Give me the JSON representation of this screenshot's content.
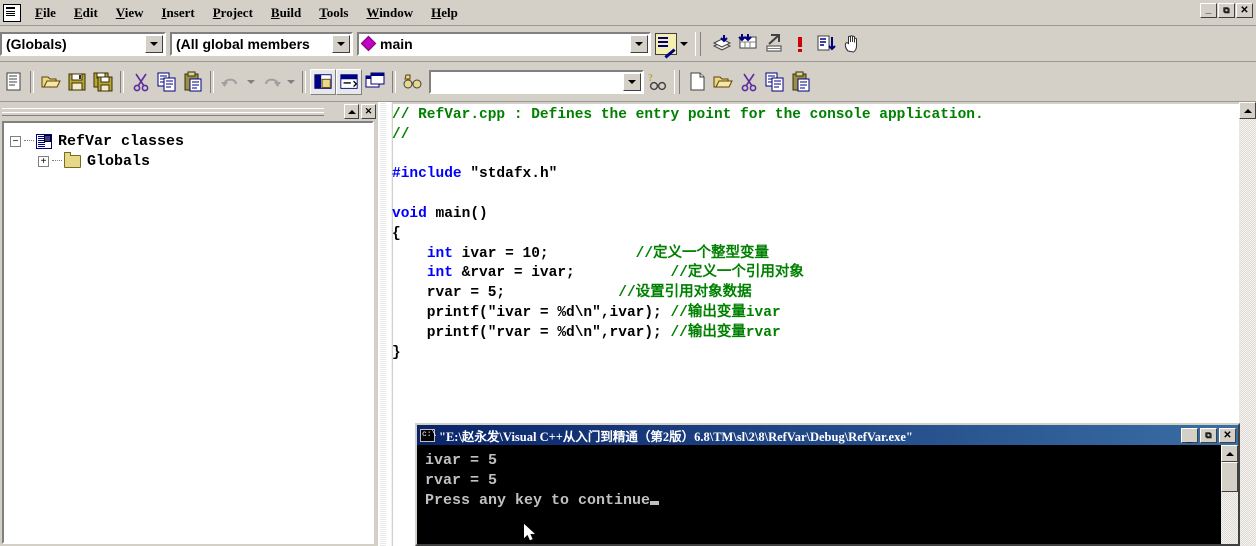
{
  "window": {
    "sys_icon": "app-icon",
    "mdi_buttons": [
      {
        "name": "minimize",
        "glyph": "_"
      },
      {
        "name": "restore",
        "glyph": "❐"
      },
      {
        "name": "close",
        "glyph": "✕"
      }
    ]
  },
  "menu": {
    "items": [
      {
        "label": "File",
        "accel": "F"
      },
      {
        "label": "Edit",
        "accel": "E"
      },
      {
        "label": "View",
        "accel": "V"
      },
      {
        "label": "Insert",
        "accel": "I"
      },
      {
        "label": "Project",
        "accel": "P"
      },
      {
        "label": "Build",
        "accel": "B"
      },
      {
        "label": "Tools",
        "accel": "T"
      },
      {
        "label": "Window",
        "accel": "W"
      },
      {
        "label": "Help",
        "accel": "H"
      }
    ]
  },
  "wizardbar": {
    "class_combo": "(Globals)",
    "member_filter_combo": "(All global members",
    "member_combo": "main",
    "member_icon": "member-diamond-icon",
    "action_icon": "wizardbar-actions-icon",
    "build_tools": [
      {
        "name": "compile",
        "label": "Compile"
      },
      {
        "name": "build",
        "label": "Build"
      },
      {
        "name": "rebuild-all",
        "label": "Rebuild All"
      },
      {
        "name": "stop-build",
        "label": "Stop Build"
      },
      {
        "name": "execute-program",
        "label": "Execute Program"
      },
      {
        "name": "go-debug",
        "label": "Go"
      }
    ]
  },
  "toolbar": {
    "find_value": "",
    "find_placeholder": "",
    "buttons": [
      {
        "name": "new-text-file",
        "label": "New Text File"
      },
      {
        "name": "open-file",
        "label": "Open"
      },
      {
        "name": "save-file",
        "label": "Save"
      },
      {
        "name": "save-all",
        "label": "Save All"
      },
      {
        "name": "cut",
        "label": "Cut"
      },
      {
        "name": "copy",
        "label": "Copy"
      },
      {
        "name": "paste",
        "label": "Paste"
      },
      {
        "name": "undo",
        "label": "Undo"
      },
      {
        "name": "redo",
        "label": "Redo"
      },
      {
        "name": "workspace-pane",
        "label": "Workspace"
      },
      {
        "name": "output-pane",
        "label": "Output"
      },
      {
        "name": "window-list",
        "label": "Window List"
      },
      {
        "name": "find-in-files",
        "label": "Find in Files"
      },
      {
        "name": "find-help",
        "label": "Search Help"
      }
    ],
    "extra_buttons": [
      {
        "name": "new-document",
        "label": "New"
      },
      {
        "name": "open-document",
        "label": "Open"
      },
      {
        "name": "cut-2",
        "label": "Cut"
      },
      {
        "name": "copy-2",
        "label": "Copy"
      },
      {
        "name": "paste-2",
        "label": "Paste"
      }
    ]
  },
  "workspace": {
    "pane_buttons": [
      {
        "name": "roll-up",
        "glyph": "▲"
      },
      {
        "name": "close-pane",
        "glyph": "✕"
      }
    ],
    "tree": [
      {
        "label": "RefVar classes",
        "icon": "classes-icon",
        "expander": "−",
        "level": 0
      },
      {
        "label": "Globals",
        "icon": "folder-icon",
        "expander": "+",
        "level": 1
      }
    ]
  },
  "editor": {
    "lines": [
      [
        {
          "t": "// RefVar.cpp : Defines the entry point for the console application.",
          "c": "cm"
        }
      ],
      [
        {
          "t": "//",
          "c": "cm"
        }
      ],
      [
        {
          "t": "",
          "c": ""
        }
      ],
      [
        {
          "t": "#include",
          "c": "pp"
        },
        {
          "t": " \"stdafx.h\"",
          "c": ""
        }
      ],
      [
        {
          "t": "",
          "c": ""
        }
      ],
      [
        {
          "t": "void",
          "c": "kw"
        },
        {
          "t": " main()",
          "c": ""
        }
      ],
      [
        {
          "t": "{",
          "c": ""
        }
      ],
      [
        {
          "t": "    ",
          "c": ""
        },
        {
          "t": "int",
          "c": "kw"
        },
        {
          "t": " ivar = 10;          ",
          "c": ""
        },
        {
          "t": "//定义一个整型变量",
          "c": "cm"
        }
      ],
      [
        {
          "t": "    ",
          "c": ""
        },
        {
          "t": "int",
          "c": "kw"
        },
        {
          "t": " &rvar = ivar;           ",
          "c": ""
        },
        {
          "t": "//定义一个引用对象",
          "c": "cm"
        }
      ],
      [
        {
          "t": "    rvar = 5;             ",
          "c": ""
        },
        {
          "t": "//设置引用对象数据",
          "c": "cm"
        }
      ],
      [
        {
          "t": "    printf(\"ivar = %d\\n\",ivar); ",
          "c": ""
        },
        {
          "t": "//输出变量ivar",
          "c": "cm"
        }
      ],
      [
        {
          "t": "    printf(\"rvar = %d\\n\",rvar); ",
          "c": ""
        },
        {
          "t": "//输出变量rvar",
          "c": "cm"
        }
      ],
      [
        {
          "t": "}",
          "c": ""
        }
      ]
    ],
    "scroll_up_glyph": "▲"
  },
  "console": {
    "title": "\"E:\\赵永发\\Visual C++从入门到精通（第2版）6.8\\TM\\sl\\2\\8\\RefVar\\Debug\\RefVar.exe\"",
    "icon": "console-icon",
    "buttons": [
      {
        "name": "minimize",
        "glyph": "_"
      },
      {
        "name": "maximize",
        "glyph": "❐"
      },
      {
        "name": "close",
        "glyph": "✕"
      }
    ],
    "output": "ivar = 5\nrvar = 5\nPress any key to continue",
    "scroll_up_glyph": "▲"
  },
  "colors": {
    "chrome": "#d4d0c8",
    "comment_green": "#008000",
    "keyword_blue": "#0000ff",
    "titlebar_blue": "#0a246a",
    "member_purple": "#c000c0"
  }
}
